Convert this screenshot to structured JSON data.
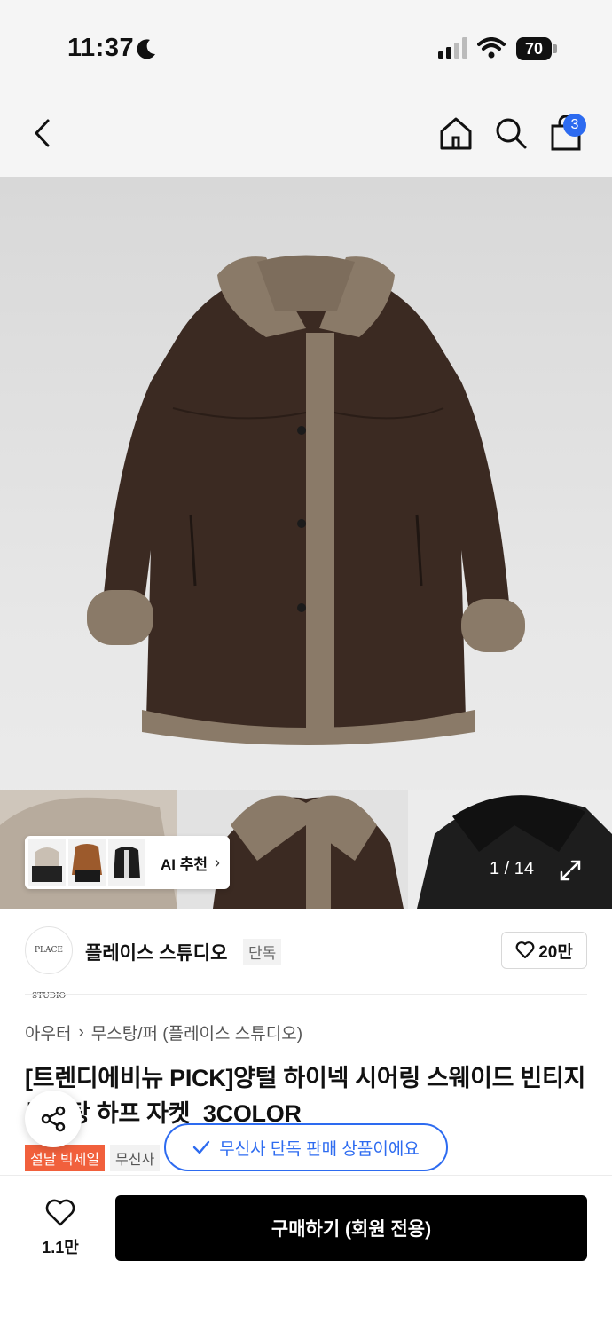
{
  "status": {
    "time": "11:37",
    "battery": "70"
  },
  "nav": {
    "cart_count": "3"
  },
  "gallery": {
    "ai_label": "AI 추천",
    "pager": "1 / 14"
  },
  "brand": {
    "name": "플레이스 스튜디오",
    "tag": "단독",
    "likes": "20만",
    "logo_text": "PLACE STUDIO"
  },
  "breadcrumb": {
    "first": "아우터",
    "second": "무스탕/퍼 (플레이스 스튜디오)"
  },
  "product": {
    "title": "[트렌디에비뉴 PICK]양털 하이넥 시어링 스웨이드 빈티지 무스탕 하프 자켓_3COLOR",
    "tags": [
      "설날 빅세일",
      "무신사"
    ]
  },
  "toast": {
    "text": "무신사 단독 판매 상품이에요"
  },
  "bottom": {
    "wish_count": "1.1만",
    "buy_label": "구매하기 (회원 전용)"
  },
  "colors": {
    "accent": "#2d6bf0",
    "sale": "#f1603c"
  }
}
